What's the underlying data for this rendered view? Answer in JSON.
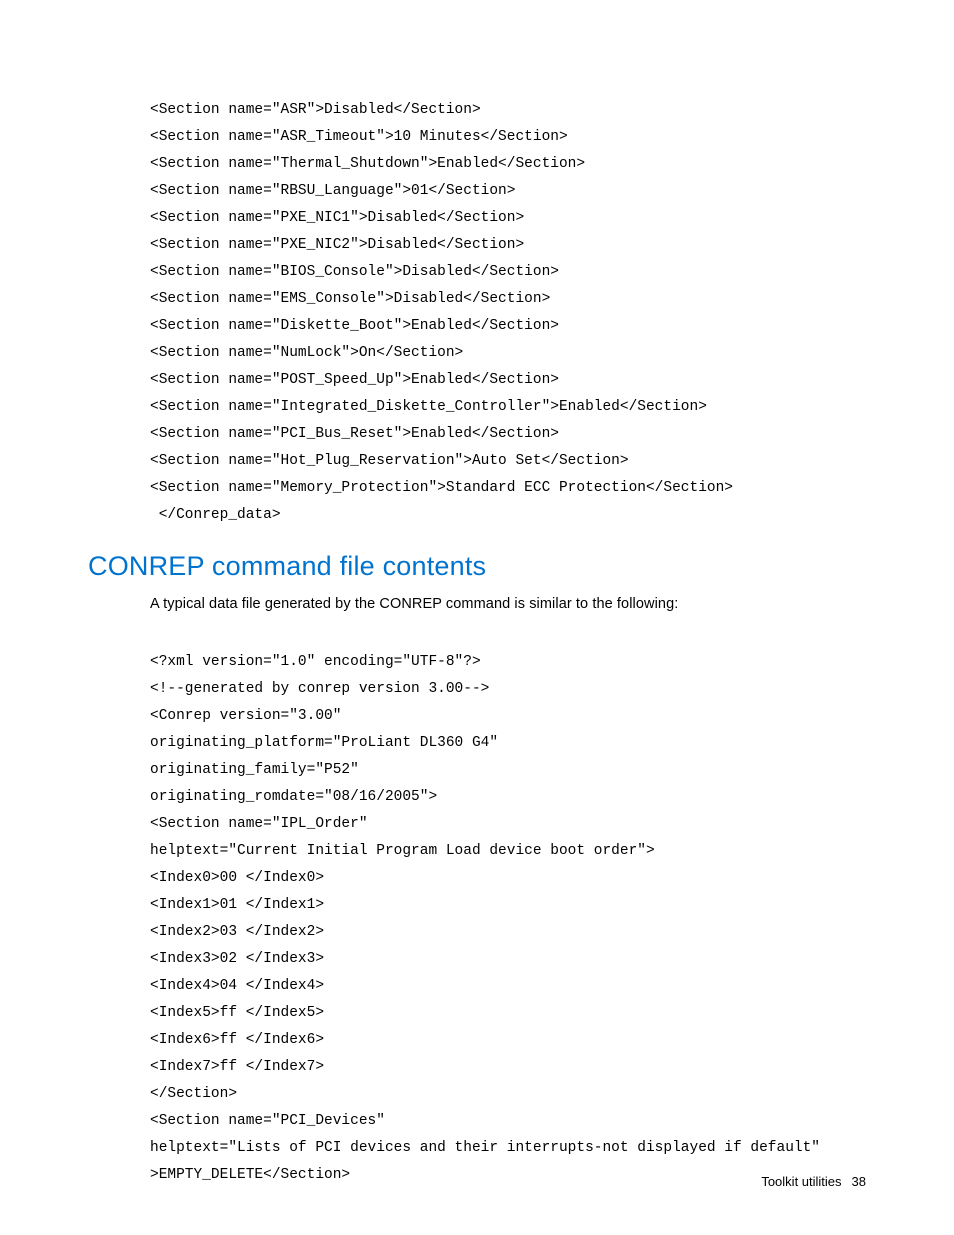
{
  "code1": {
    "l0": "<Section name=\"ASR\">Disabled</Section>",
    "l1": "<Section name=\"ASR_Timeout\">10 Minutes</Section>",
    "l2": "<Section name=\"Thermal_Shutdown\">Enabled</Section>",
    "l3": "<Section name=\"RBSU_Language\">01</Section>",
    "l4": "<Section name=\"PXE_NIC1\">Disabled</Section>",
    "l5": "<Section name=\"PXE_NIC2\">Disabled</Section>",
    "l6": "<Section name=\"BIOS_Console\">Disabled</Section>",
    "l7": "<Section name=\"EMS_Console\">Disabled</Section>",
    "l8": "<Section name=\"Diskette_Boot\">Enabled</Section>",
    "l9": "<Section name=\"NumLock\">On</Section>",
    "l10": "<Section name=\"POST_Speed_Up\">Enabled</Section>",
    "l11": "<Section name=\"Integrated_Diskette_Controller\">Enabled</Section>",
    "l12": "<Section name=\"PCI_Bus_Reset\">Enabled</Section>",
    "l13": "<Section name=\"Hot_Plug_Reservation\">Auto Set</Section>",
    "l14": "<Section name=\"Memory_Protection\">Standard ECC Protection</Section>",
    "l15": " </Conrep_data>"
  },
  "heading": "CONREP command file contents",
  "intro": "A typical data file generated by the CONREP command is similar to the following:",
  "code2": {
    "l0": "<?xml version=\"1.0\" encoding=\"UTF-8\"?>",
    "l1": "<!--generated by conrep version 3.00-->",
    "l2": "<Conrep version=\"3.00\"",
    "l3": "originating_platform=\"ProLiant DL360 G4\"",
    "l4": "originating_family=\"P52\"",
    "l5": "originating_romdate=\"08/16/2005\">",
    "l6": "<Section name=\"IPL_Order\"",
    "l7": "helptext=\"Current Initial Program Load device boot order\">",
    "l8": "<Index0>00 </Index0>",
    "l9": "<Index1>01 </Index1>",
    "l10": "<Index2>03 </Index2>",
    "l11": "<Index3>02 </Index3>",
    "l12": "<Index4>04 </Index4>",
    "l13": "<Index5>ff </Index5>",
    "l14": "<Index6>ff </Index6>",
    "l15": "<Index7>ff </Index7>",
    "l16": "</Section>",
    "l17": "<Section name=\"PCI_Devices\"",
    "l18": "helptext=\"Lists of PCI devices and their interrupts-not displayed if default\"",
    "l19": ">EMPTY_DELETE</Section>"
  },
  "footer": {
    "label": "Toolkit utilities",
    "page": "38"
  }
}
